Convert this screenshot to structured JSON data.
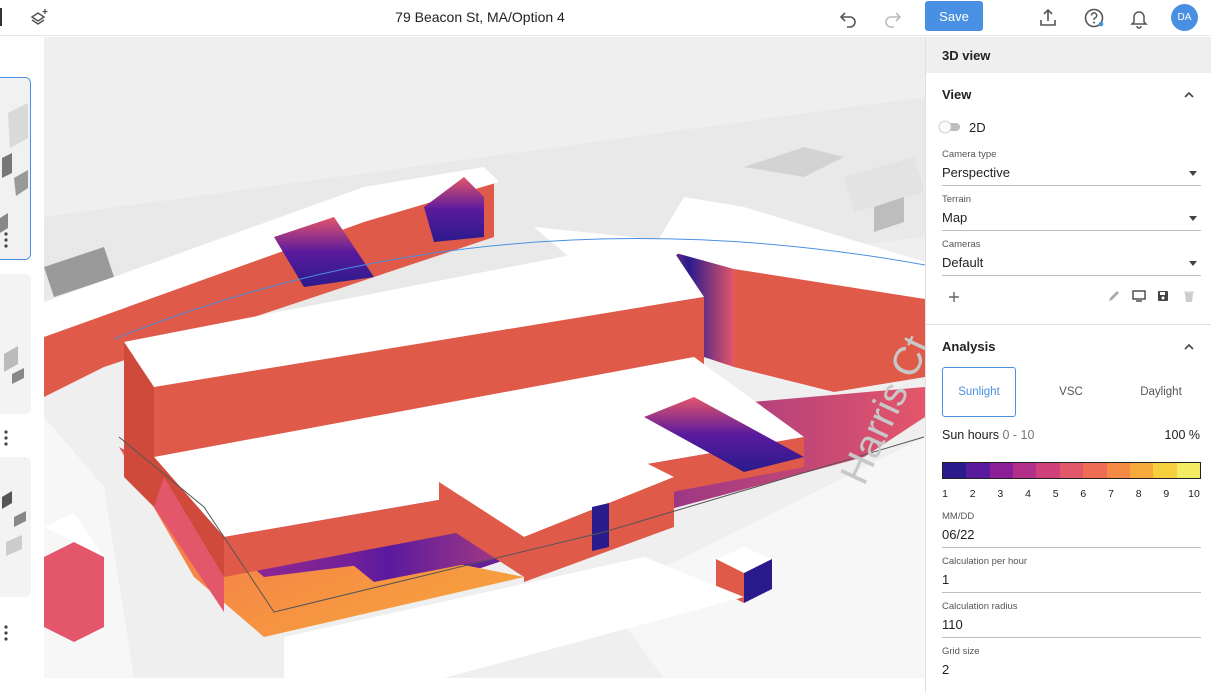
{
  "header": {
    "title": "79 Beacon St, MA/Option 4",
    "save_label": "Save",
    "avatar_initials": "DA"
  },
  "viewport": {
    "street_label": "Harris Ct"
  },
  "panel": {
    "heading": "3D view",
    "view": {
      "title": "View",
      "toggle_label": "2D",
      "toggle_on": false,
      "camera_type_label": "Camera type",
      "camera_type_value": "Perspective",
      "terrain_label": "Terrain",
      "terrain_value": "Map",
      "cameras_label": "Cameras",
      "cameras_value": "Default"
    },
    "analysis": {
      "title": "Analysis",
      "tabs": [
        "Sunlight",
        "VSC",
        "Daylight"
      ],
      "active_tab": "Sunlight",
      "sun_hours_label": "Sun hours",
      "sun_hours_range": "0 - 10",
      "percent": "100 %",
      "legend_colors": [
        "#2a1a8c",
        "#5a1a9e",
        "#8a1f97",
        "#b3308a",
        "#d0407a",
        "#e4566a",
        "#f06d55",
        "#f58a45",
        "#f7a93b",
        "#f5cf3c",
        "#f4ec62"
      ],
      "legend_numbers": [
        "1",
        "2",
        "3",
        "4",
        "5",
        "6",
        "7",
        "8",
        "9",
        "10"
      ],
      "date_label": "MM/DD",
      "date_value": "06/22",
      "calc_per_hour_label": "Calculation per hour",
      "calc_per_hour_value": "1",
      "calc_radius_label": "Calculation radius",
      "calc_radius_value": "110",
      "grid_size_label": "Grid size",
      "grid_size_value": "2"
    }
  },
  "icons": [
    "layers-add-icon",
    "undo-icon",
    "redo-icon",
    "share-icon",
    "help-icon",
    "bell-icon",
    "plus-icon",
    "pencil-icon",
    "monitor-icon",
    "save-icon",
    "trash-icon",
    "chevron-up-icon",
    "more-vert-icon"
  ]
}
